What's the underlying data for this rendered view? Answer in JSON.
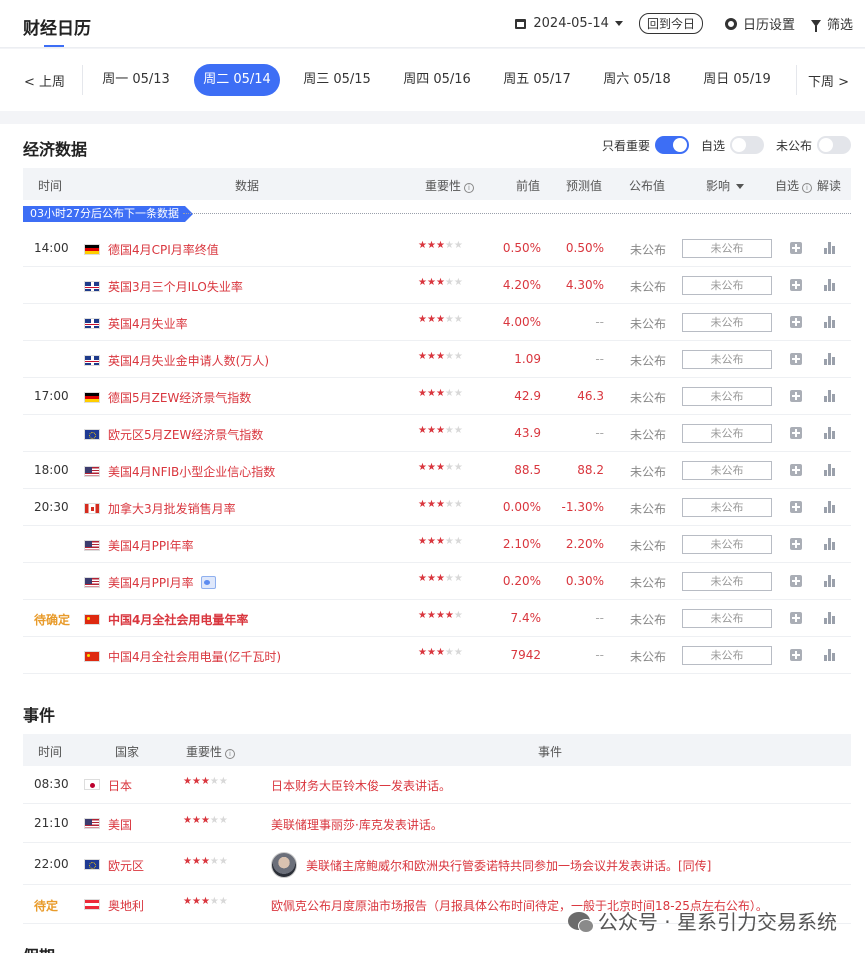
{
  "header": {
    "title": "财经日历",
    "date": "2024-05-14",
    "today_label": "回到今日",
    "settings_label": "日历设置",
    "filter_label": "筛选"
  },
  "week": {
    "prev_label": "< 上周",
    "next_label": "下周 >",
    "days": [
      {
        "label": "周一 05/13",
        "active": false
      },
      {
        "label": "周二 05/14",
        "active": true
      },
      {
        "label": "周三 05/15",
        "active": false
      },
      {
        "label": "周四 05/16",
        "active": false
      },
      {
        "label": "周五 05/17",
        "active": false
      },
      {
        "label": "周六 05/18",
        "active": false
      },
      {
        "label": "周日 05/19",
        "active": false
      }
    ]
  },
  "economic": {
    "title": "经济数据",
    "toggles": [
      {
        "label": "只看重要",
        "on": true
      },
      {
        "label": "自选",
        "on": false
      },
      {
        "label": "未公布",
        "on": false
      }
    ],
    "headers": {
      "time": "时间",
      "data": "数据",
      "importance": "重要性",
      "prev": "前值",
      "forecast": "预测值",
      "actual": "公布值",
      "impact": "影响",
      "watch": "自选",
      "explain": "解读"
    },
    "countdown": "03小时27分后公布下一条数据",
    "rows": [
      {
        "time": "14:00",
        "flag": "de",
        "name": "德国4月CPI月率终值",
        "stars": 3,
        "prev": "0.50%",
        "forecast": "0.50%",
        "actual": "未公布",
        "impact": "未公布",
        "bold": false,
        "doc": false
      },
      {
        "time": "",
        "flag": "gb",
        "name": "英国3月三个月ILO失业率",
        "stars": 3,
        "prev": "4.20%",
        "forecast": "4.30%",
        "actual": "未公布",
        "impact": "未公布",
        "bold": false,
        "doc": false
      },
      {
        "time": "",
        "flag": "gb",
        "name": "英国4月失业率",
        "stars": 3,
        "prev": "4.00%",
        "forecast": "--",
        "actual": "未公布",
        "impact": "未公布",
        "bold": false,
        "doc": false
      },
      {
        "time": "",
        "flag": "gb",
        "name": "英国4月失业金申请人数(万人)",
        "stars": 3,
        "prev": "1.09",
        "forecast": "--",
        "actual": "未公布",
        "impact": "未公布",
        "bold": false,
        "doc": false
      },
      {
        "time": "17:00",
        "flag": "de",
        "name": "德国5月ZEW经济景气指数",
        "stars": 3,
        "prev": "42.9",
        "forecast": "46.3",
        "actual": "未公布",
        "impact": "未公布",
        "bold": false,
        "doc": false
      },
      {
        "time": "",
        "flag": "eu",
        "name": "欧元区5月ZEW经济景气指数",
        "stars": 3,
        "prev": "43.9",
        "forecast": "--",
        "actual": "未公布",
        "impact": "未公布",
        "bold": false,
        "doc": false
      },
      {
        "time": "18:00",
        "flag": "us",
        "name": "美国4月NFIB小型企业信心指数",
        "stars": 3,
        "prev": "88.5",
        "forecast": "88.2",
        "actual": "未公布",
        "impact": "未公布",
        "bold": false,
        "doc": false
      },
      {
        "time": "20:30",
        "flag": "ca",
        "name": "加拿大3月批发销售月率",
        "stars": 3,
        "prev": "0.00%",
        "forecast": "-1.30%",
        "actual": "未公布",
        "impact": "未公布",
        "bold": false,
        "doc": false
      },
      {
        "time": "",
        "flag": "us",
        "name": "美国4月PPI年率",
        "stars": 3,
        "prev": "2.10%",
        "forecast": "2.20%",
        "actual": "未公布",
        "impact": "未公布",
        "bold": false,
        "doc": false
      },
      {
        "time": "",
        "flag": "us",
        "name": "美国4月PPI月率",
        "stars": 3,
        "prev": "0.20%",
        "forecast": "0.30%",
        "actual": "未公布",
        "impact": "未公布",
        "bold": false,
        "doc": true
      },
      {
        "time": "待确定",
        "flag": "cn",
        "name": "中国4月全社会用电量年率",
        "stars": 4,
        "prev": "7.4%",
        "forecast": "--",
        "actual": "未公布",
        "impact": "未公布",
        "bold": true,
        "doc": false,
        "pending": true
      },
      {
        "time": "",
        "flag": "cn",
        "name": "中国4月全社会用电量(亿千瓦时)",
        "stars": 3,
        "prev": "7942",
        "forecast": "--",
        "actual": "未公布",
        "impact": "未公布",
        "bold": false,
        "doc": false
      }
    ]
  },
  "events": {
    "title": "事件",
    "headers": {
      "time": "时间",
      "country": "国家",
      "importance": "重要性",
      "event": "事件"
    },
    "rows": [
      {
        "time": "08:30",
        "flag": "jp",
        "country": "日本",
        "stars": 3,
        "text": "日本财务大臣铃木俊一发表讲话。",
        "avatar": false
      },
      {
        "time": "21:10",
        "flag": "us",
        "country": "美国",
        "stars": 3,
        "text": "美联储理事丽莎·库克发表讲话。",
        "avatar": false
      },
      {
        "time": "22:00",
        "flag": "eu",
        "country": "欧元区",
        "stars": 3,
        "text": "美联储主席鲍威尔和欧洲央行管委诺特共同参加一场会议并发表讲话。[同传]",
        "avatar": true
      },
      {
        "time": "待定",
        "flag": "at",
        "country": "奥地利",
        "stars": 3,
        "text": "欧佩克公布月度原油市场报告（月报具体公布时间待定，一般于北京时间18-25点左右公布）。",
        "avatar": false,
        "pending": true
      }
    ]
  },
  "watermark": "公众号 · 星系引力交易系统",
  "holiday_title": "假期"
}
